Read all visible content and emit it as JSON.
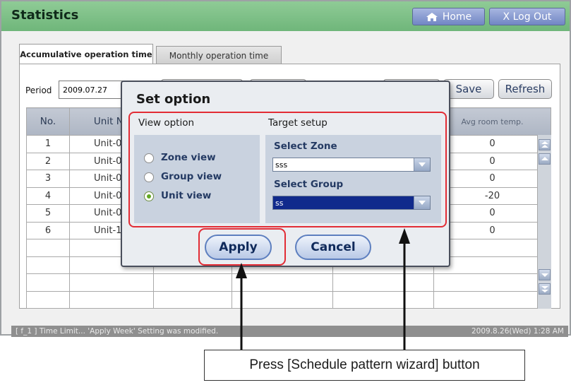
{
  "app": {
    "title": "Statistics"
  },
  "header": {
    "home_label": "Home",
    "logout_label": "X Log Out"
  },
  "tabs": [
    {
      "label": "Accumulative operation time",
      "active": true
    },
    {
      "label": "Monthly operation time",
      "active": false
    }
  ],
  "filter": {
    "period_label": "Period",
    "period_value": "2009.07.27"
  },
  "actions": {
    "save_label": "Save",
    "refresh_label": "Refresh"
  },
  "table": {
    "headers": {
      "no": "No.",
      "unit": "Unit Na",
      "avg": "Avg room temp."
    },
    "rows": [
      {
        "no": "1",
        "unit": "Unit-0",
        "avg": "0"
      },
      {
        "no": "2",
        "unit": "Unit-0",
        "avg": "0"
      },
      {
        "no": "3",
        "unit": "Unit-0",
        "avg": "0"
      },
      {
        "no": "4",
        "unit": "Unit-0",
        "avg": "-20"
      },
      {
        "no": "5",
        "unit": "Unit-0",
        "avg": "0"
      },
      {
        "no": "6",
        "unit": "Unit-1",
        "avg": "0"
      }
    ]
  },
  "dialog": {
    "title": "Set option",
    "view_option_header": "View option",
    "target_setup_header": "Target setup",
    "radios": [
      {
        "label": "Zone view",
        "checked": false
      },
      {
        "label": "Group view",
        "checked": false
      },
      {
        "label": "Unit view",
        "checked": true
      }
    ],
    "select_zone_label": "Select Zone",
    "select_zone_value": "sss",
    "select_group_label": "Select Group",
    "select_group_value": "ss",
    "apply_label": "Apply",
    "cancel_label": "Cancel"
  },
  "status": {
    "message": "[ f_1 ] Time Limit... 'Apply Week' Setting was modified.",
    "datetime": "2009.8.26(Wed)  1:28 AM"
  },
  "annotation": {
    "callout_text": "Press [Schedule pattern wizard] button"
  },
  "colors": {
    "title_bar": "#7dbf86",
    "highlight_frame": "#e22c35",
    "button_blue": "#7186c4",
    "selected_item": "#102a8c"
  },
  "icons": {
    "home": "house-icon",
    "scroll_top": "double-up-arrow-icon",
    "scroll_up": "up-arrow-icon",
    "scroll_down": "down-arrow-icon",
    "scroll_bottom": "double-down-arrow-icon",
    "dropdown": "dropdown-arrow-icon"
  }
}
